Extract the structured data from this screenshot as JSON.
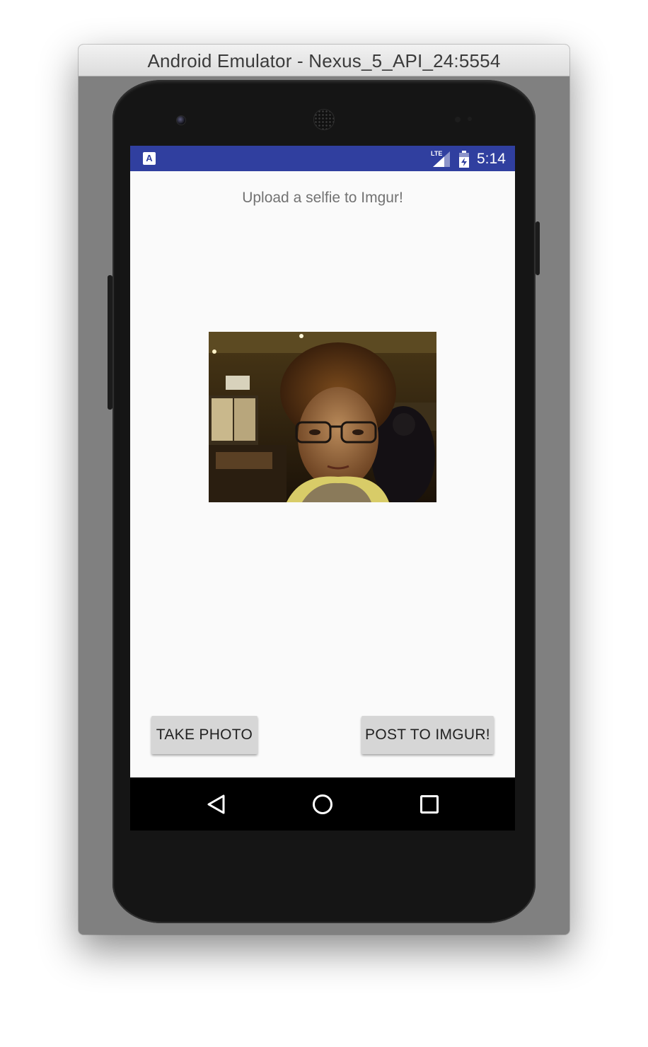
{
  "window": {
    "title": "Android Emulator - Nexus_5_API_24:5554"
  },
  "status_bar": {
    "notification_icon": "A",
    "network_label": "LTE",
    "time": "5:14",
    "background_color": "#303f9f"
  },
  "app": {
    "heading": "Upload a selfie to Imgur!",
    "selfie_photo": "selfie-photo",
    "take_photo_label": "TAKE PHOTO",
    "post_label": "POST TO IMGUR!"
  },
  "nav_bar": {
    "icons": [
      "back-icon",
      "home-icon",
      "recents-icon"
    ]
  }
}
